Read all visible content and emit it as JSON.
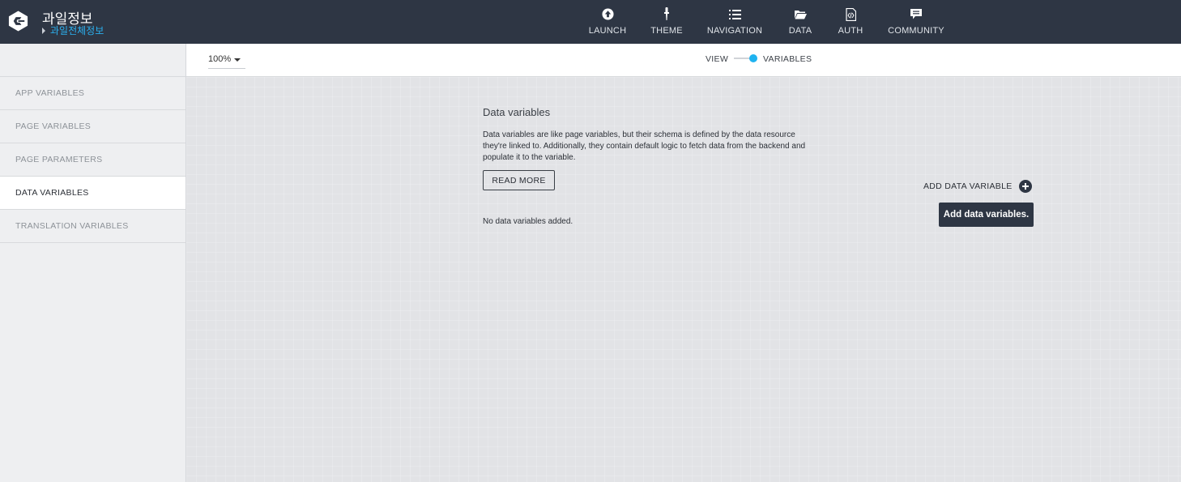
{
  "header": {
    "app_title": "과일정보",
    "breadcrumb": "과일전체정보",
    "nav": [
      {
        "label": "LAUNCH",
        "icon": "upload-icon"
      },
      {
        "label": "THEME",
        "icon": "brush-icon"
      },
      {
        "label": "NAVIGATION",
        "icon": "list-icon"
      },
      {
        "label": "DATA",
        "icon": "folder-icon"
      },
      {
        "label": "AUTH",
        "icon": "code-file-icon"
      },
      {
        "label": "COMMUNITY",
        "icon": "chat-icon"
      }
    ]
  },
  "sidebar": {
    "items": [
      {
        "label": "APP VARIABLES"
      },
      {
        "label": "PAGE VARIABLES"
      },
      {
        "label": "PAGE PARAMETERS"
      },
      {
        "label": "DATA VARIABLES",
        "active": true
      },
      {
        "label": "TRANSLATION VARIABLES"
      }
    ]
  },
  "toolbar": {
    "zoom": "100%",
    "view_label": "VIEW",
    "variables_label": "VARIABLES"
  },
  "main": {
    "title": "Data variables",
    "description": "Data variables are like page variables, but their schema is defined by the data resource they're linked to. Additionally, they contain default logic to fetch data from the backend and populate it to the variable.",
    "read_more": "READ MORE",
    "empty_message": "No data variables added.",
    "add_label": "ADD DATA VARIABLE",
    "tooltip": "Add data variables."
  },
  "colors": {
    "topbar": "#2e3644",
    "accent": "#1fb3f0",
    "canvas": "#e2e3e6"
  }
}
